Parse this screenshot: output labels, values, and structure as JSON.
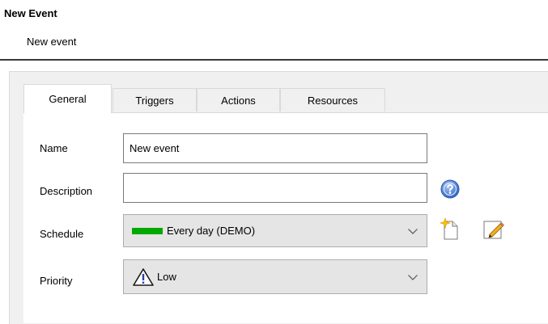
{
  "page": {
    "title": "New Event",
    "subtitle": "New event"
  },
  "tabs": [
    {
      "label": "General",
      "active": true
    },
    {
      "label": "Triggers",
      "active": false
    },
    {
      "label": "Actions",
      "active": false
    },
    {
      "label": "Resources",
      "active": false
    }
  ],
  "form": {
    "name": {
      "label": "Name",
      "value": "New event"
    },
    "description": {
      "label": "Description",
      "value": ""
    },
    "schedule": {
      "label": "Schedule",
      "value": "Every day (DEMO)",
      "swatch_color": "#00a800"
    },
    "priority": {
      "label": "Priority",
      "value": "Low"
    }
  },
  "icons": {
    "help": "help-icon",
    "new_schedule": "new-schedule-icon",
    "edit_schedule": "edit-schedule-icon",
    "warning": "warning-icon",
    "dropdown": "chevron-down-icon"
  },
  "colors": {
    "help_blue": "#3c78d8",
    "divider": "#3a3a3a"
  }
}
